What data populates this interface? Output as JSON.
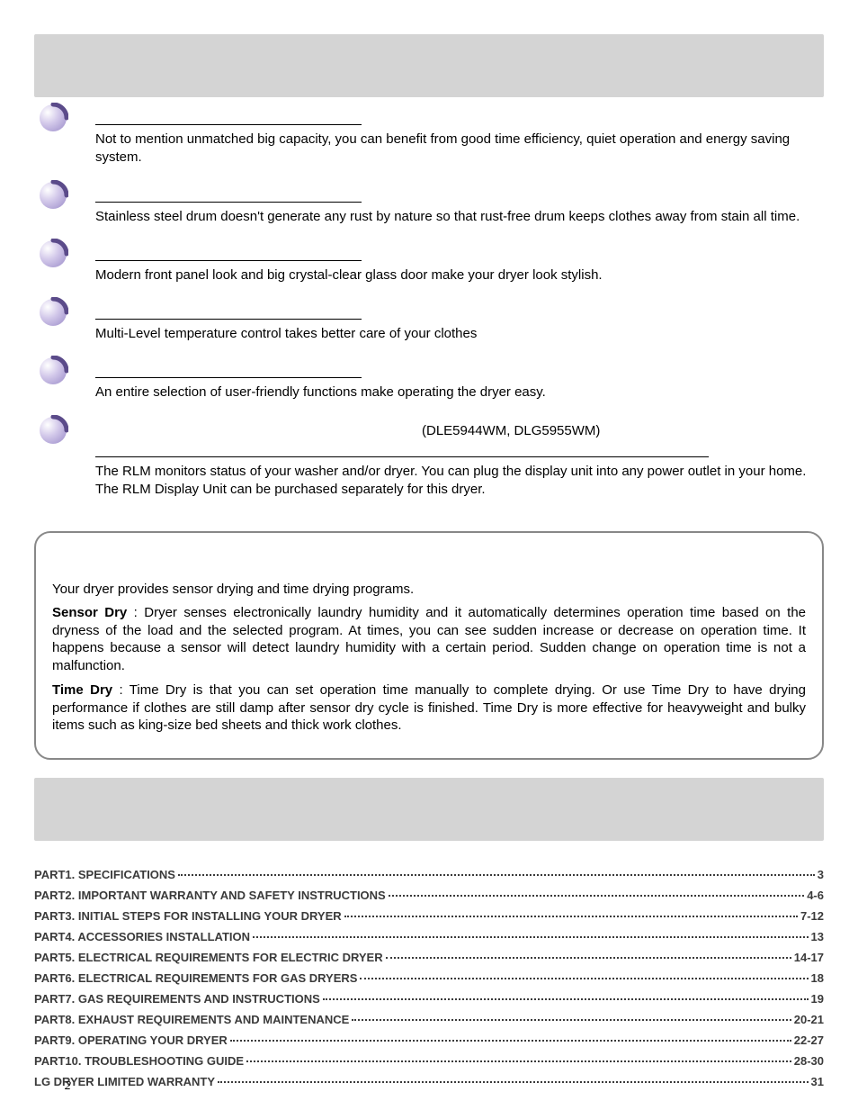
{
  "features": [
    {
      "title_line_wide": false,
      "body": "Not to mention unmatched big capacity, you can benefit from good time efficiency, quiet operation and energy saving system."
    },
    {
      "title_line_wide": false,
      "body": "Stainless steel drum doesn't generate any rust by nature so that rust-free drum keeps clothes away from stain all time."
    },
    {
      "title_line_wide": false,
      "body": "Modern front panel look and big crystal-clear glass door make your dryer look stylish."
    },
    {
      "title_line_wide": false,
      "body": "Multi-Level temperature control takes better care of your clothes"
    },
    {
      "title_line_wide": false,
      "body": "An entire selection of user-friendly functions make operating the dryer easy."
    },
    {
      "title_line_wide": true,
      "right_note": "(DLE5944WM, DLG5955WM)",
      "body": "The RLM monitors status of your washer and/or dryer. You can plug the display unit into any power outlet in your home. The RLM Display Unit can be purchased separately for this dryer."
    }
  ],
  "drying": {
    "intro": "Your dryer provides sensor drying and time drying programs.",
    "para1_lead": "Sensor Dry",
    "para1_body": " : Dryer senses electronically laundry humidity and it automatically determines operation time based on the dryness of the load and the selected program. At times, you can see sudden increase or decrease on operation time. It happens because a sensor will detect laundry humidity with a certain period. Sudden change on operation time is not a malfunction.",
    "para2_lead": "Time Dry",
    "para2_body": " : Time Dry is that you can set operation time manually to complete drying. Or use Time Dry to have drying performance if clothes are still damp after sensor dry cycle is finished. Time Dry is more effective for heavyweight and bulky items such as king-size bed sheets and thick work clothes."
  },
  "toc": [
    {
      "label": "PART1. SPECIFICATIONS",
      "page": "3"
    },
    {
      "label": "PART2. IMPORTANT WARRANTY AND SAFETY INSTRUCTIONS",
      "page": "4-6"
    },
    {
      "label": "PART3. INITIAL STEPS FOR INSTALLING YOUR DRYER",
      "page": "7-12"
    },
    {
      "label": "PART4. ACCESSORIES INSTALLATION",
      "page": "13"
    },
    {
      "label": "PART5. ELECTRICAL REQUIREMENTS FOR ELECTRIC DRYER",
      "page": "14-17"
    },
    {
      "label": "PART6. ELECTRICAL REQUIREMENTS FOR GAS DRYERS",
      "page": "18"
    },
    {
      "label": "PART7. GAS REQUIREMENTS AND INSTRUCTIONS",
      "page": "19"
    },
    {
      "label": "PART8. EXHAUST REQUIREMENTS AND MAINTENANCE",
      "page": "20-21"
    },
    {
      "label": "PART9. OPERATING YOUR DRYER",
      "page": "22-27"
    },
    {
      "label": "PART10. TROUBLESHOOTING GUIDE",
      "page": "28-30"
    },
    {
      "label": "LG DRYER LIMITED WARRANTY",
      "page": "31"
    }
  ],
  "page_number": "2"
}
